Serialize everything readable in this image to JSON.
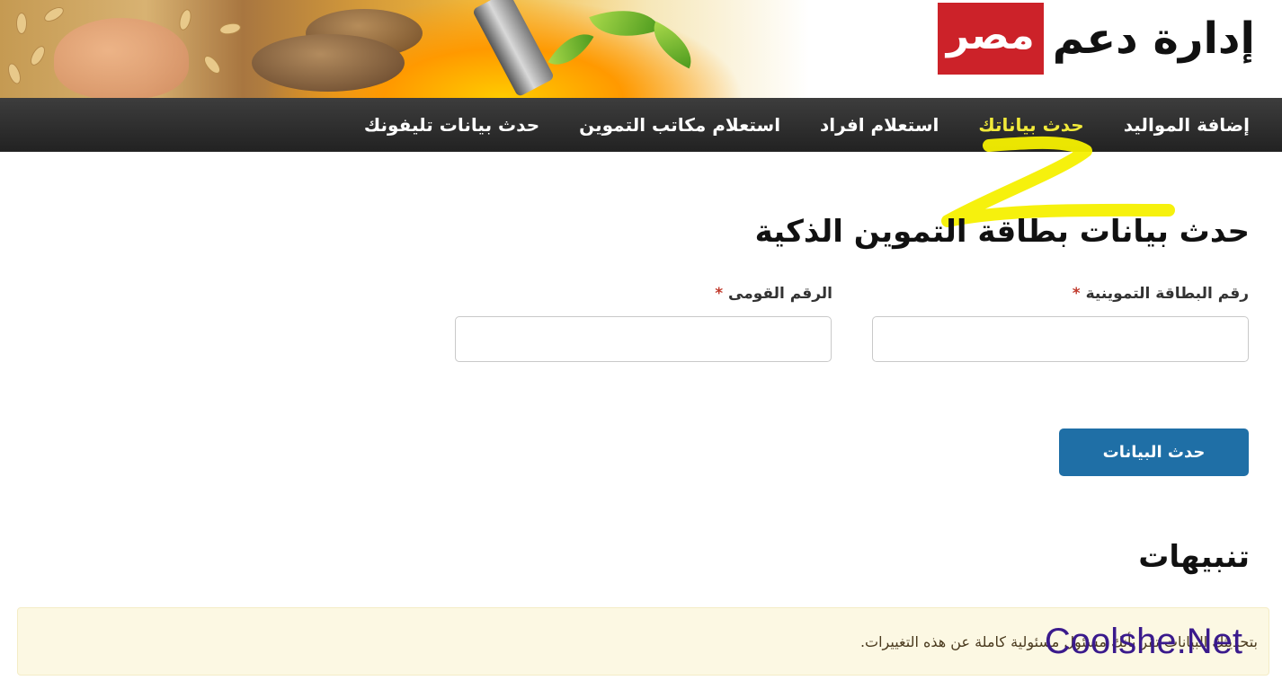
{
  "logo": {
    "text": "إدارة دعم",
    "box_text": "مصر",
    "box_color": "#cc2229"
  },
  "nav": {
    "items": [
      {
        "label": "إضافة المواليد",
        "active": false
      },
      {
        "label": "حدث بياناتك",
        "active": true
      },
      {
        "label": "استعلام افراد",
        "active": false
      },
      {
        "label": "استعلام مكاتب التموين",
        "active": false
      },
      {
        "label": "حدث بيانات تليفونك",
        "active": false
      }
    ],
    "active_color": "#f2ea3a"
  },
  "form": {
    "title": "حدث بيانات بطاقة التموين الذكية",
    "card_number_label": "رقم البطاقة التموينية",
    "national_id_label": "الرقم القومى",
    "required_mark": "*",
    "card_number_value": "",
    "national_id_value": "",
    "submit_label": "حدث البيانات",
    "submit_color": "#1f6fa6"
  },
  "alerts": {
    "title": "تنبيهات",
    "message": "بتحديثك البيانات تقر بأنك مسئول مسئولية كاملة عن هذه التغييرات.",
    "background": "#fcf8e3"
  },
  "watermark": {
    "text": "Coolshe.Net"
  }
}
